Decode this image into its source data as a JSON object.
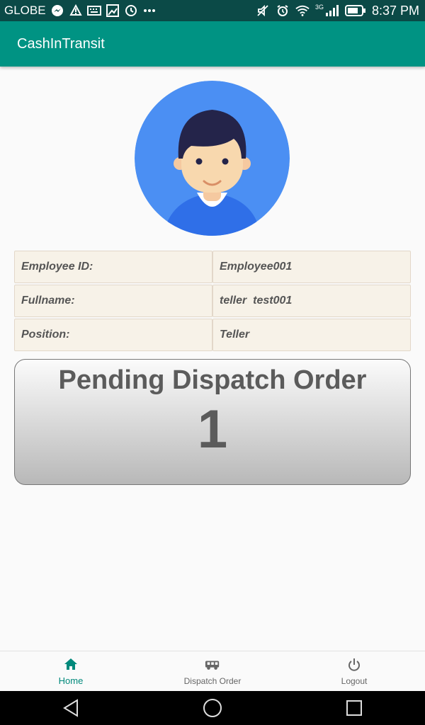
{
  "status_bar": {
    "carrier": "GLOBE",
    "network": "3G",
    "time": "8:37 PM",
    "left_icons": [
      "messenger-icon",
      "warning-icon",
      "keyboard-icon",
      "image-icon",
      "sync-icon",
      "more-icon"
    ],
    "right_icons": [
      "mute-icon",
      "alarm-icon",
      "wifi-icon",
      "signal-icon",
      "battery-icon"
    ]
  },
  "app_bar": {
    "title": "CashInTransit",
    "color": "#009383"
  },
  "profile": {
    "rows": [
      {
        "label": "Employee ID:",
        "value": "Employee001"
      },
      {
        "label": "Fullname:",
        "value": "teller  test001"
      },
      {
        "label": "Position:",
        "value": "Teller"
      }
    ]
  },
  "pending": {
    "title": "Pending Dispatch Order",
    "count": "1"
  },
  "bottom_nav": {
    "active": "Home",
    "accent": "#00897b",
    "items": [
      {
        "label": "Home",
        "icon": "home-icon"
      },
      {
        "label": "Dispatch Order",
        "icon": "van-icon"
      },
      {
        "label": "Logout",
        "icon": "power-icon"
      }
    ]
  }
}
